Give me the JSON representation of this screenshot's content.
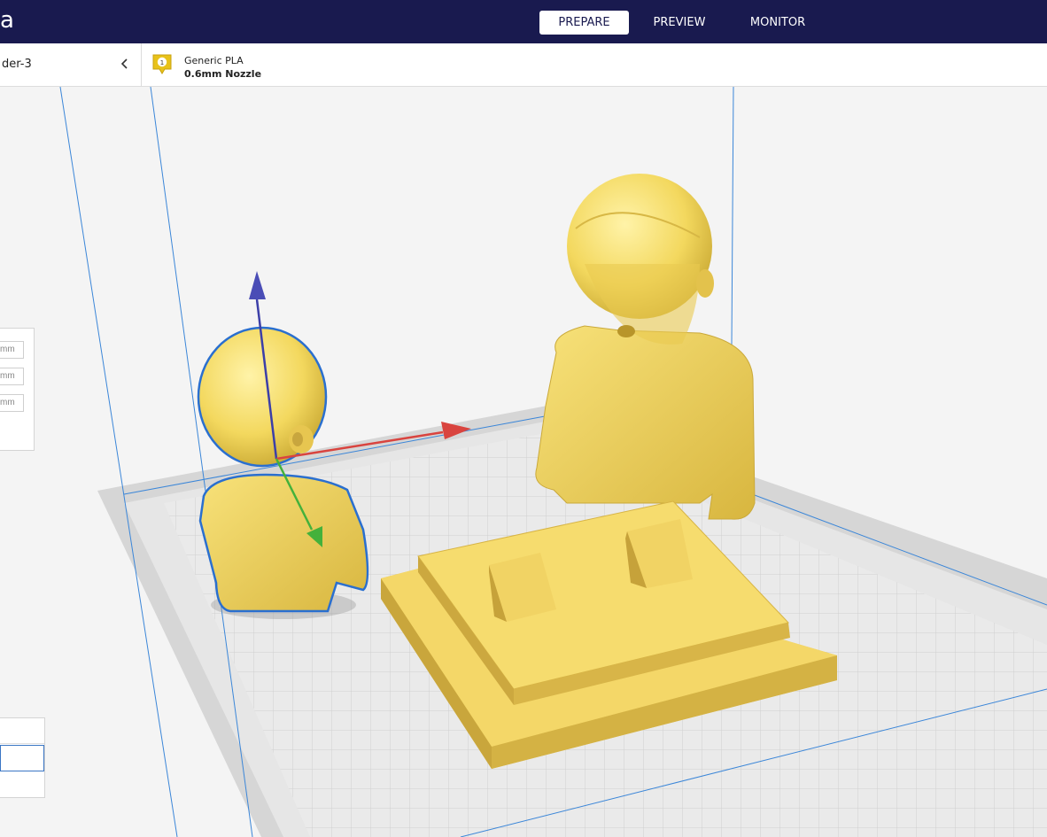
{
  "app": {
    "logo_fragment": "a"
  },
  "header": {
    "tabs": [
      {
        "label": "PREPARE",
        "active": true
      },
      {
        "label": "PREVIEW",
        "active": false
      },
      {
        "label": "MONITOR",
        "active": false
      }
    ]
  },
  "toolbar": {
    "printer_name": "der-3",
    "extruder": {
      "number": "1",
      "material": "Generic PLA",
      "nozzle": "0.6mm Nozzle"
    }
  },
  "move_panel": {
    "fields": [
      {
        "unit": "mm"
      },
      {
        "unit": "mm"
      },
      {
        "unit": "mm"
      }
    ]
  },
  "colors": {
    "header_bg": "#191a4f",
    "model": "#f5d65e",
    "selection_outline": "#2a6fcf",
    "axis_x": "#d9443f",
    "axis_y": "#44b13b",
    "axis_z": "#3c3fa8",
    "extruder_badge": "#e8c21a"
  }
}
